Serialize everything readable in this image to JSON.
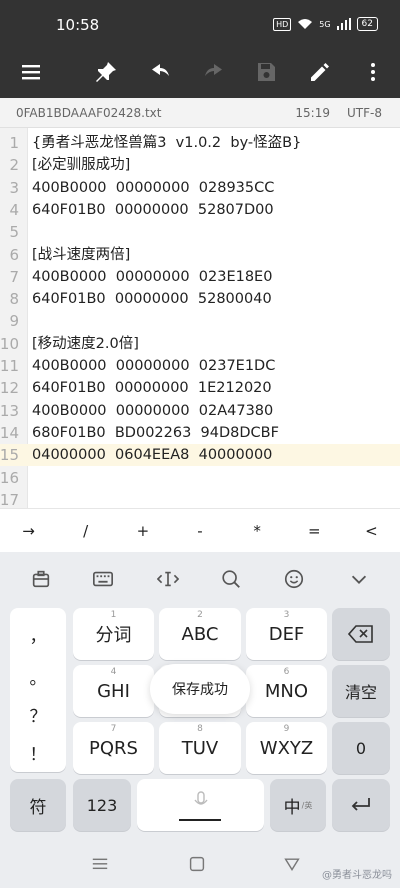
{
  "status_bar": {
    "time": "10:58",
    "hd": "HD",
    "net": "5G",
    "battery": "62"
  },
  "toolbar": {
    "icons": [
      "menu-icon",
      "pin-icon",
      "undo-icon",
      "redo-icon",
      "save-icon",
      "edit-icon",
      "more-icon"
    ]
  },
  "file_bar": {
    "filename": "0FAB1BDAAAF02428.txt",
    "cursor": "15:19",
    "encoding": "UTF-8"
  },
  "editor": {
    "highlighted_line": 15,
    "lines": [
      {
        "n": "1",
        "text": "{勇者斗恶龙怪兽篇3  v1.0.2  by-怪盗B}"
      },
      {
        "n": "2",
        "text": "[必定驯服成功]"
      },
      {
        "n": "3",
        "text": "400B0000  00000000  028935CC"
      },
      {
        "n": "4",
        "text": "640F01B0  00000000  52807D00"
      },
      {
        "n": "5",
        "text": ""
      },
      {
        "n": "6",
        "text": "[战斗速度两倍]"
      },
      {
        "n": "7",
        "text": "400B0000  00000000  023E18E0"
      },
      {
        "n": "8",
        "text": "640F01B0  00000000  52800040"
      },
      {
        "n": "9",
        "text": ""
      },
      {
        "n": "10",
        "text": "[移动速度2.0倍]"
      },
      {
        "n": "11",
        "text": "400B0000  00000000  0237E1DC"
      },
      {
        "n": "12",
        "text": "640F01B0  00000000  1E212020"
      },
      {
        "n": "13",
        "text": "400B0000  00000000  02A47380"
      },
      {
        "n": "14",
        "text": "680F01B0  BD002263  94D8DCBF"
      },
      {
        "n": "15",
        "text": "04000000  0604EEA8  40000000"
      },
      {
        "n": "16",
        "text": ""
      },
      {
        "n": "17",
        "text": ""
      }
    ]
  },
  "symbol_bar": [
    "→",
    "/",
    "+",
    "-",
    "*",
    "=",
    "<"
  ],
  "keyboard": {
    "tool_icons": [
      "clipboard-icon",
      "keyboard-icon",
      "cursor-move-icon",
      "search-icon",
      "emoji-icon",
      "collapse-icon"
    ],
    "punctuation": [
      "，",
      "。",
      "？",
      "！"
    ],
    "row1": {
      "k1": "分词",
      "n1": "1",
      "k2": "ABC",
      "n2": "2",
      "k3": "DEF",
      "n3": "3"
    },
    "row2": {
      "k1": "GHI",
      "n1": "4",
      "k3": "MNO",
      "n3": "6",
      "right": "清空"
    },
    "row3": {
      "k1": "PQRS",
      "n1": "7",
      "k2": "TUV",
      "n2": "8",
      "k3": "WXYZ",
      "n3": "9",
      "right": "0"
    },
    "bottom": {
      "sym": "符",
      "num": "123",
      "lang": "中",
      "lang_sub": "/英"
    },
    "toast": "保存成功"
  },
  "watermark": "@勇者斗恶龙吗"
}
